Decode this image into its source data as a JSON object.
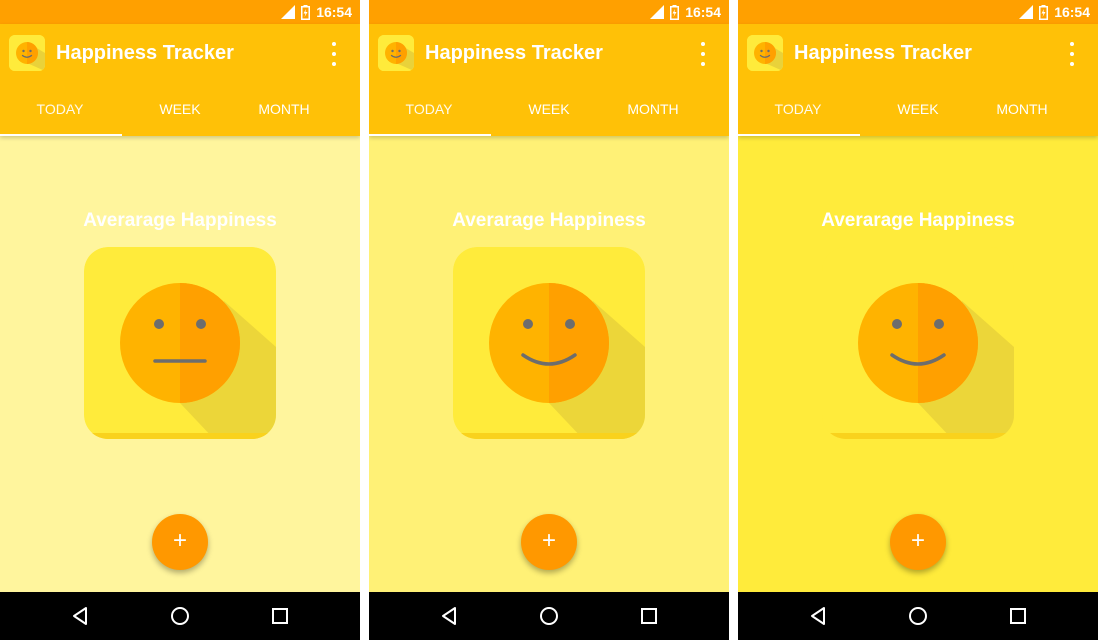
{
  "colors": {
    "status_bar": "#FFA000",
    "app_bar": "#FFC107",
    "accent_fab": "#FF9800",
    "tile": "#FFEB3B",
    "face_light": "#FFB300",
    "face_dark": "#FFA000",
    "feature": "#6D6D6D"
  },
  "screens": [
    {
      "background": "#FFF59D",
      "status": {
        "time": "16:54",
        "icons": [
          "signal-icon",
          "battery-charging-icon"
        ]
      },
      "app_bar": {
        "title": "Happiness Tracker",
        "overflow_icon": "more-vert-icon"
      },
      "tabs": [
        {
          "label": "TODAY",
          "active": true
        },
        {
          "label": "WEEK"
        },
        {
          "label": "MONTH"
        }
      ],
      "heading": "Averarage Happiness",
      "mood": "neutral",
      "fab": {
        "label": "+",
        "icon": "add-icon"
      },
      "nav": [
        "back-icon",
        "home-icon",
        "recents-icon"
      ]
    },
    {
      "background": "#FFF176",
      "status": {
        "time": "16:54",
        "icons": [
          "signal-icon",
          "battery-charging-icon"
        ]
      },
      "app_bar": {
        "title": "Happiness Tracker",
        "overflow_icon": "more-vert-icon"
      },
      "tabs": [
        {
          "label": "TODAY",
          "active": true
        },
        {
          "label": "WEEK"
        },
        {
          "label": "MONTH"
        }
      ],
      "heading": "Averarage Happiness",
      "mood": "happy",
      "fab": {
        "label": "+",
        "icon": "add-icon"
      },
      "nav": [
        "back-icon",
        "home-icon",
        "recents-icon"
      ]
    },
    {
      "background": "#FFEB3B",
      "status": {
        "time": "16:54",
        "icons": [
          "signal-icon",
          "battery-charging-icon"
        ]
      },
      "app_bar": {
        "title": "Happiness Tracker",
        "overflow_icon": "more-vert-icon"
      },
      "tabs": [
        {
          "label": "TODAY",
          "active": true
        },
        {
          "label": "WEEK"
        },
        {
          "label": "MONTH"
        }
      ],
      "heading": "Averarage Happiness",
      "mood": "happy",
      "fab": {
        "label": "+",
        "icon": "add-icon"
      },
      "nav": [
        "back-icon",
        "home-icon",
        "recents-icon"
      ]
    }
  ]
}
